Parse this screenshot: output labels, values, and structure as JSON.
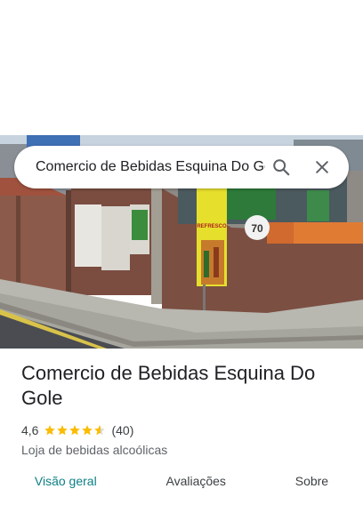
{
  "search": {
    "query": "Comercio de Bebidas Esquina Do Gole"
  },
  "photo": {
    "sign_text": "REFRESCO",
    "number_text": "70"
  },
  "place": {
    "name": "Comercio de Bebidas Esquina Do Gole",
    "rating": "4,6",
    "rating_value": 4.6,
    "review_count": "(40)",
    "category": "Loja de bebidas alcoólicas"
  },
  "tabs": [
    {
      "label": "Visão geral",
      "active": true
    },
    {
      "label": "Avaliações",
      "active": false
    },
    {
      "label": "Sobre",
      "active": false
    }
  ],
  "colors": {
    "star": "#fbbc04",
    "active_tab": "#0b7f85"
  }
}
